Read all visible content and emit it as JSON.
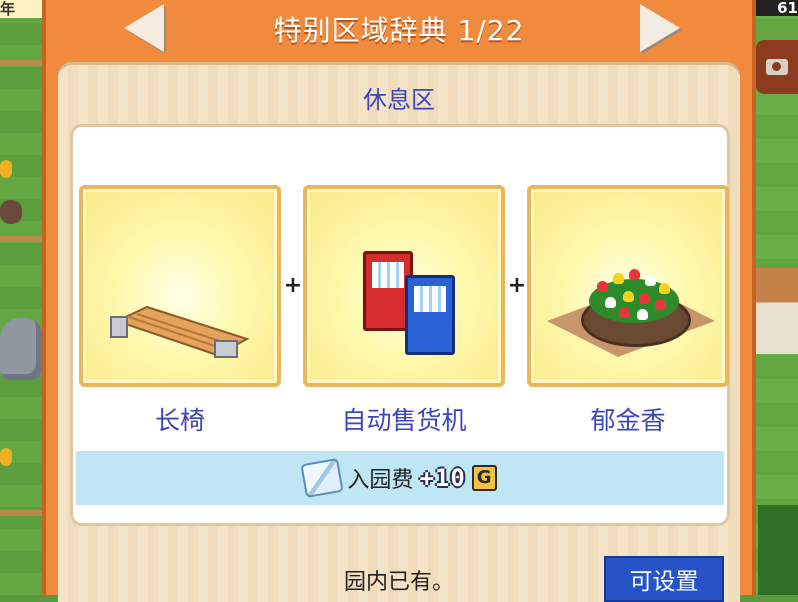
{
  "dialog": {
    "title": "特别区域辞典 1/22",
    "zone_name": "休息区",
    "items": [
      {
        "label": "长椅",
        "icon": "bench-icon"
      },
      {
        "label": "自动售货机",
        "icon": "vending-machine-icon"
      },
      {
        "label": "郁金香",
        "icon": "tulip-bed-icon"
      }
    ],
    "plus_sign": "+",
    "bonus": {
      "label": "入园费",
      "value": "+10",
      "currency": "G",
      "icon": "ticket-icon"
    },
    "footer_text": "园内已有。",
    "set_button_label": "可设置"
  },
  "background": {
    "left_top_text": "年",
    "right_top_text": "61"
  },
  "colors": {
    "title_bar": "#f08a3c",
    "label_text": "#3d46b8",
    "fee_bar": "#bfe6f4",
    "button": "#2654c8"
  }
}
